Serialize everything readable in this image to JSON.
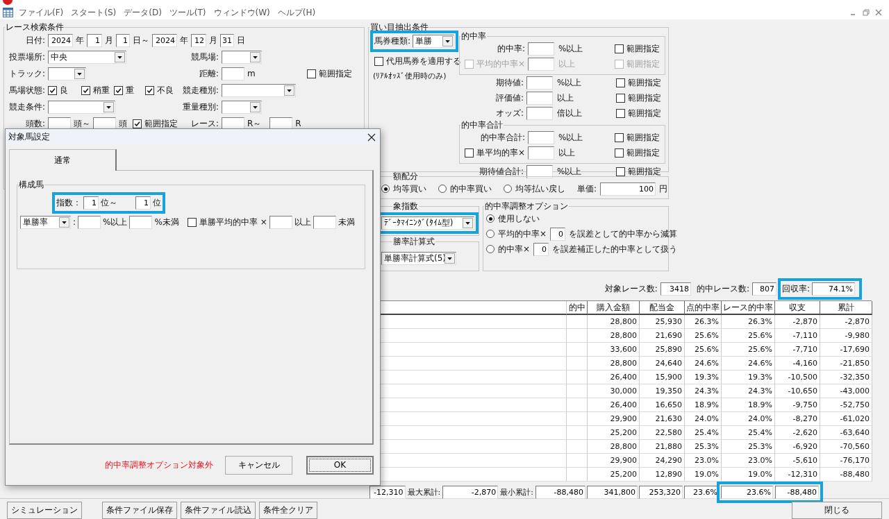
{
  "menu": [
    "ファイル(F)",
    "スタート(S)",
    "データ(D)",
    "ツール(T)",
    "ウィンドウ(W)",
    "ヘルプ(H)"
  ],
  "race_search": {
    "title": "レース検索条件",
    "date": {
      "label": "日付:",
      "from": {
        "year": "2024",
        "year_unit": "年",
        "month": "1",
        "month_unit": "月",
        "day": "1",
        "day_unit": "日～"
      },
      "to": {
        "year": "2024",
        "year_unit": "年",
        "month": "12",
        "month_unit": "月",
        "day": "31",
        "day_unit": "日"
      }
    },
    "venue_type": {
      "label": "投票場所:",
      "value": "中央"
    },
    "racecourse": {
      "label": "競馬場:"
    },
    "track": {
      "label": "トラック:"
    },
    "distance": {
      "label": "距離:",
      "unit": "m"
    },
    "distance_range": {
      "label": "範囲指定",
      "checked": false
    },
    "going": {
      "label": "馬場状態:",
      "options": [
        {
          "label": "良",
          "checked": true
        },
        {
          "label": "稍重",
          "checked": true
        },
        {
          "label": "重",
          "checked": true
        },
        {
          "label": "不良",
          "checked": true
        }
      ]
    },
    "race_type": {
      "label": "競走種別:"
    },
    "race_condition": {
      "label": "競走条件:"
    },
    "weight_type": {
      "label": "重量種別:"
    },
    "runners": {
      "label": "頭数:",
      "from_unit": "頭～",
      "to_unit": "頭"
    },
    "runners_range": {
      "label": "範囲指定",
      "checked": true
    },
    "race_no": {
      "label": "レース:",
      "from_unit": "R～",
      "to_unit": "R"
    }
  },
  "bet_conditions": {
    "title": "買い目抽出条件",
    "ticket_type": {
      "label": "馬券種類:",
      "value": "単勝"
    },
    "substitute": {
      "label": "代用馬券を適用する",
      "checked": false
    },
    "note": "(ﾘｱﾙｵｯｽﾞ使用時のみ)",
    "sections": [
      {
        "title": "的中率",
        "rows": [
          {
            "kind": "field",
            "label": "的中率:",
            "unit": "%以上",
            "disabled": false,
            "range": {
              "label": "範囲指定",
              "checked": false
            }
          },
          {
            "kind": "check-field",
            "label": "平均的中率×",
            "checked": false,
            "unit": "以上",
            "disabled": true,
            "range": {
              "label": "範囲指定",
              "checked": false
            }
          }
        ]
      },
      {
        "rows": [
          {
            "kind": "field",
            "label": "期待値:",
            "unit": "%以上",
            "disabled": false,
            "range": {
              "label": "範囲指定",
              "checked": false
            }
          },
          {
            "kind": "field",
            "label": "評価値:",
            "unit": "以上",
            "disabled": false,
            "range": {
              "label": "範囲指定",
              "checked": false
            }
          },
          {
            "kind": "field",
            "label": "オッズ:",
            "unit": "倍以上",
            "disabled": false,
            "range": {
              "label": "範囲指定",
              "checked": false
            }
          }
        ]
      },
      {
        "title": "的中率合計",
        "rows": [
          {
            "kind": "field",
            "label": "的中率合計:",
            "unit": "%以上",
            "disabled": false,
            "range": {
              "label": "範囲指定",
              "checked": false
            }
          },
          {
            "kind": "check-field",
            "label": "単平均的率×",
            "checked": false,
            "unit": "以上",
            "disabled": false,
            "range": {
              "label": "範囲指定",
              "checked": false
            }
          }
        ]
      },
      {
        "rows": [
          {
            "kind": "field",
            "label": "期待値合計:",
            "unit": "%以上",
            "disabled": false,
            "range": {
              "label": "範囲指定",
              "checked": false
            }
          }
        ]
      }
    ]
  },
  "allocation": {
    "title": "額配分",
    "options": [
      {
        "label": "均等買い",
        "selected": true
      },
      {
        "label": "的中率買い",
        "selected": false
      },
      {
        "label": "均等払い戻し",
        "selected": false
      }
    ],
    "unit_price": {
      "label": "単価:",
      "value": "100",
      "unit": "円"
    }
  },
  "index": {
    "title": "象指数",
    "value": "ﾃﾞｰﾀﾏｲﾆﾝｸﾞ(ﾀｲﾑ型)"
  },
  "formula": {
    "title": "勝率計算式",
    "value": "単勝率計算式(5)"
  },
  "adjust": {
    "title": "的中率調整オプション",
    "options": [
      {
        "kind": "plain",
        "label": "使用しない",
        "selected": true
      },
      {
        "kind": "with-field",
        "label": "平均的中率×",
        "value": "0",
        "after": "を誤差として的中率から減算",
        "selected": false
      },
      {
        "kind": "with-field",
        "label": "的中率×",
        "value": "0",
        "after": "を誤差補正した的中率として扱う",
        "selected": false
      }
    ]
  },
  "results": {
    "stats": [
      {
        "label": "対象レース数:",
        "value": "3418"
      },
      {
        "label": "的中レース数:",
        "value": "807"
      },
      {
        "label": "回収率:",
        "value": "74.1%"
      }
    ],
    "columns": [
      "的中",
      "購入金額",
      "配当金",
      "点的中率",
      "レース的中率",
      "収支",
      "累計"
    ],
    "rows": [
      [
        "",
        "28,800",
        "25,930",
        "26.3%",
        "26.3%",
        "-2,870",
        "-2,870"
      ],
      [
        "",
        "28,800",
        "21,690",
        "25.6%",
        "25.6%",
        "-7,110",
        "-9,980"
      ],
      [
        "",
        "33,600",
        "25,890",
        "25.6%",
        "25.6%",
        "-7,710",
        "-17,690"
      ],
      [
        "",
        "28,800",
        "24,640",
        "24.6%",
        "24.6%",
        "-4,160",
        "-21,850"
      ],
      [
        "",
        "26,400",
        "15,900",
        "19.3%",
        "19.3%",
        "-10,500",
        "-32,350"
      ],
      [
        "",
        "30,000",
        "19,350",
        "24.3%",
        "24.3%",
        "-10,650",
        "-43,000"
      ],
      [
        "",
        "26,400",
        "16,650",
        "18.9%",
        "18.9%",
        "-9,750",
        "-52,750"
      ],
      [
        "",
        "29,900",
        "21,630",
        "24.0%",
        "24.0%",
        "-8,270",
        "-61,020"
      ],
      [
        "",
        "25,200",
        "22,580",
        "25.4%",
        "25.4%",
        "-2,620",
        "-63,640"
      ],
      [
        "",
        "28,800",
        "21,880",
        "25.3%",
        "25.3%",
        "-6,920",
        "-70,560"
      ],
      [
        "",
        "29,900",
        "24,290",
        "23.0%",
        "23.0%",
        "-5,610",
        "-76,170"
      ],
      [
        "",
        "25,200",
        "12,890",
        "19.0%",
        "19.0%",
        "-12,310",
        "-88,480"
      ]
    ],
    "summary": {
      "min_balance": "-12,310",
      "max_cumulative": {
        "label": "最大累計:",
        "value": "-2,870"
      },
      "min_cumulative": {
        "label": "最小累計:",
        "value": "-88,480"
      },
      "totals": [
        "341,800",
        "253,320",
        "23.6%",
        "23.6%",
        "-88,480"
      ]
    }
  },
  "footer": {
    "left": [
      "シミュレーション",
      "条件ファイル保存",
      "条件ファイル読込",
      "条件全クリア"
    ],
    "right": "閉じる"
  },
  "dialog": {
    "title": "対象馬設定",
    "tabs": [
      {
        "label": "通常",
        "selected": true
      }
    ],
    "group": {
      "title": "構成馬",
      "index": {
        "label": "指数：",
        "from": "1",
        "from_unit": "位～",
        "to": "1",
        "to_unit": "位"
      },
      "rate": {
        "select": "単勝率",
        "colon": ":",
        "min_unit": "%以上",
        "max_unit": "%未満",
        "avg": {
          "label": "単勝平均的中率 ×",
          "checked": false
        },
        "avg_min_unit": "以上",
        "avg_max_unit": "未満"
      }
    },
    "note": "的中率調整オプション対象外",
    "buttons": [
      {
        "label": "キャンセル",
        "kind": "normal"
      },
      {
        "label": "OK",
        "kind": "default"
      }
    ]
  }
}
